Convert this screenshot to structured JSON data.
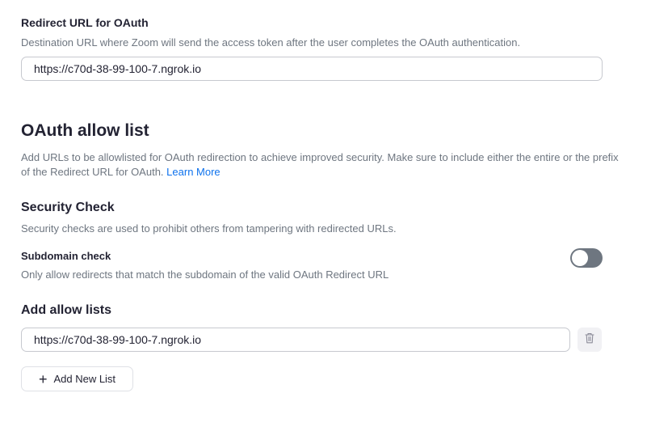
{
  "redirect": {
    "title": "Redirect URL for OAuth",
    "description": "Destination URL where Zoom will send the access token after the user completes the OAuth authentication.",
    "value": "https://c70d-38-99-100-7.ngrok.io"
  },
  "allow_list": {
    "heading": "OAuth allow list",
    "description": "Add URLs to be allowlisted for OAuth redirection to achieve improved security. Make sure to include either the entire or the prefix of the Redirect URL for OAuth.",
    "learn_more": "Learn More"
  },
  "security": {
    "heading": "Security Check",
    "description": "Security checks are used to prohibit others from tampering with redirected URLs.",
    "subdomain_title": "Subdomain check",
    "subdomain_description": "Only allow redirects that match the subdomain of the valid OAuth Redirect URL",
    "subdomain_enabled": false
  },
  "add_lists": {
    "heading": "Add allow lists",
    "entries": [
      "https://c70d-38-99-100-7.ngrok.io"
    ],
    "delete_icon": "trash-icon",
    "add_button_icon": "plus-icon",
    "add_button_label": "Add New List"
  },
  "colors": {
    "text": "#232333",
    "muted": "#6e7680",
    "link": "#0e72ed",
    "toggle_off": "#6e7680"
  }
}
